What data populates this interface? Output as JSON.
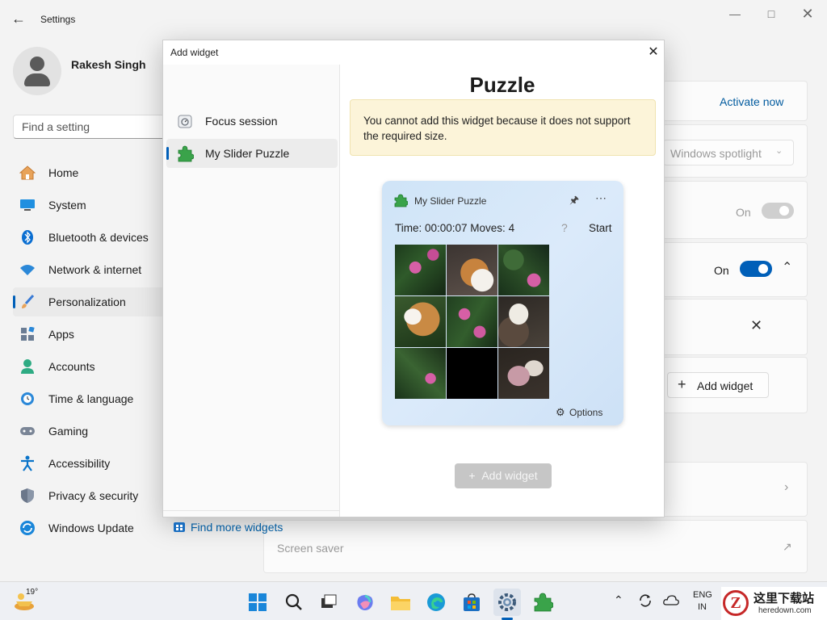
{
  "settings": {
    "title": "Settings",
    "user_name": "Rakesh Singh",
    "search_placeholder": "Find a setting",
    "nav": [
      {
        "label": "Home",
        "icon": "home-icon"
      },
      {
        "label": "System",
        "icon": "monitor-icon"
      },
      {
        "label": "Bluetooth & devices",
        "icon": "bluetooth-icon"
      },
      {
        "label": "Network & internet",
        "icon": "wifi-icon"
      },
      {
        "label": "Personalization",
        "icon": "brush-icon"
      },
      {
        "label": "Apps",
        "icon": "apps-icon"
      },
      {
        "label": "Accounts",
        "icon": "person-icon"
      },
      {
        "label": "Time & language",
        "icon": "clock-globe-icon"
      },
      {
        "label": "Gaming",
        "icon": "gamepad-icon"
      },
      {
        "label": "Accessibility",
        "icon": "accessibility-icon"
      },
      {
        "label": "Privacy & security",
        "icon": "shield-icon"
      },
      {
        "label": "Windows Update",
        "icon": "update-icon"
      }
    ],
    "selected_nav": "Personalization",
    "right": {
      "activate_link": "Activate now",
      "dropdown_value": "Windows spotlight",
      "toggle1_label": "On",
      "toggle2_label": "On",
      "add_widget_label": "Add widget",
      "screen_saver_label": "Screen saver"
    }
  },
  "dialog": {
    "title": "Add widget",
    "widgets": [
      {
        "label": "Focus session",
        "icon": "focus-timer-icon"
      },
      {
        "label": "My Slider Puzzle",
        "icon": "puzzle-icon"
      }
    ],
    "selected_widget": "My Slider Puzzle",
    "find_more": "Find more widgets",
    "panel_title": "Puzzle",
    "warning": "You cannot add this widget because it does not support the required size.",
    "preview": {
      "title": "My Slider Puzzle",
      "status": "Time: 00:00:07 Moves: 4",
      "help": "?",
      "start": "Start",
      "options": "Options"
    },
    "add_button": "Add widget"
  },
  "taskbar": {
    "weather_temp": "19°",
    "lang_top": "ENG",
    "lang_bottom": "IN",
    "watermark_main": "这里下载站",
    "watermark_url": "heredown.com"
  },
  "colors": {
    "accent": "#005fb8",
    "warning_bg": "#fcf4d9"
  }
}
